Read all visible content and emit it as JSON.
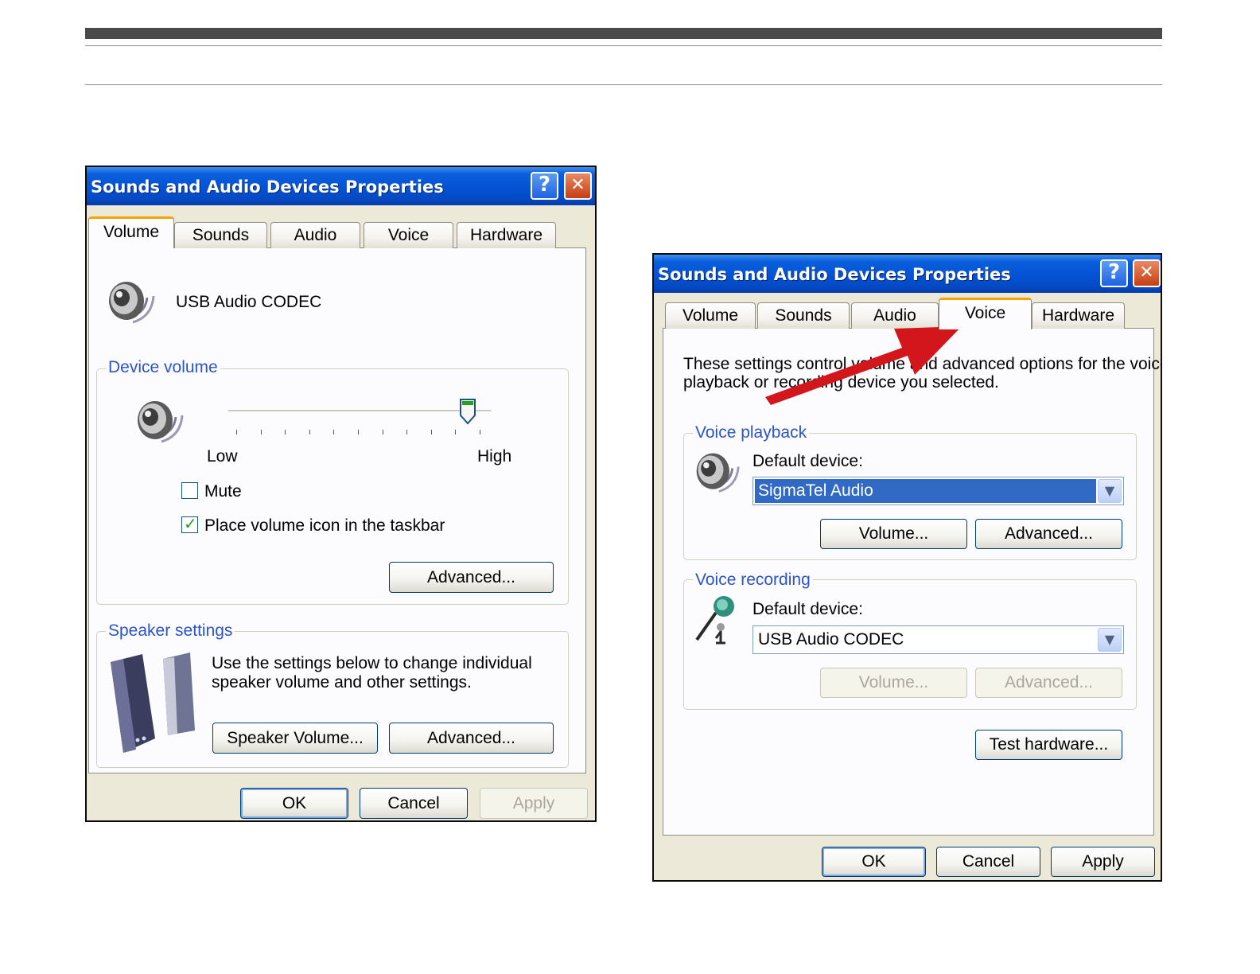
{
  "left_dialog": {
    "title": "Sounds and Audio Devices Properties",
    "help_glyph": "?",
    "close_glyph": "✕",
    "tabs": [
      "Volume",
      "Sounds",
      "Audio",
      "Voice",
      "Hardware"
    ],
    "active_tab": "Volume",
    "device_name": "USB Audio CODEC",
    "device_volume": {
      "label": "Device volume",
      "low_label": "Low",
      "high_label": "High",
      "level": 0.94,
      "mute_label": "Mute",
      "mute_checked": false,
      "taskbar_label": "Place volume icon in the taskbar",
      "taskbar_checked": true,
      "advanced_label": "Advanced..."
    },
    "speaker_settings": {
      "label": "Speaker settings",
      "description_line1": "Use the settings below to change individual",
      "description_line2": "speaker volume and other settings.",
      "speaker_volume_label": "Speaker Volume...",
      "advanced_label": "Advanced..."
    },
    "footer": {
      "ok": "OK",
      "cancel": "Cancel",
      "apply": "Apply"
    }
  },
  "right_dialog": {
    "title": "Sounds and Audio Devices Properties",
    "help_glyph": "?",
    "close_glyph": "✕",
    "tabs": [
      "Volume",
      "Sounds",
      "Audio",
      "Voice",
      "Hardware"
    ],
    "active_tab": "Voice",
    "description_line1": "These settings control volume and advanced options for the voice",
    "description_line2": "playback or recording device you selected.",
    "voice_playback": {
      "label": "Voice playback",
      "default_device_label": "Default device:",
      "device": "SigmaTel Audio",
      "volume_label": "Volume...",
      "advanced_label": "Advanced..."
    },
    "voice_recording": {
      "label": "Voice recording",
      "default_device_label": "Default device:",
      "device": "USB Audio CODEC",
      "volume_label": "Volume...",
      "advanced_label": "Advanced..."
    },
    "test_hardware_label": "Test hardware...",
    "footer": {
      "ok": "OK",
      "cancel": "Cancel",
      "apply": "Apply"
    }
  },
  "annotation": {
    "arrow_color": "#d3161c",
    "points_to": "Voice"
  },
  "colors": {
    "titlebar": "#0554d6",
    "group_label": "#2b55c6",
    "selection": "#316ac5",
    "active_tab_accent": "#f7a200"
  }
}
